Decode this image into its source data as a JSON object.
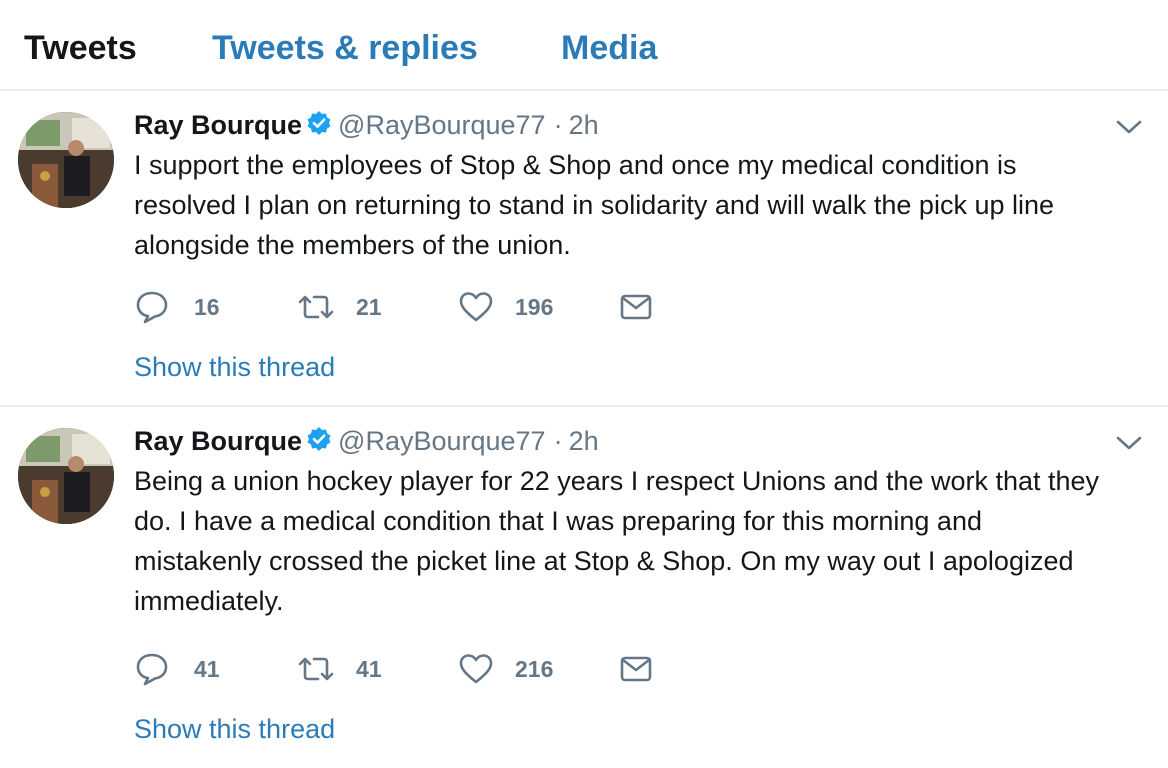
{
  "tabs": [
    {
      "label": "Tweets",
      "active": true
    },
    {
      "label": "Tweets & replies",
      "active": false
    },
    {
      "label": "Media",
      "active": false
    }
  ],
  "colors": {
    "accent": "#2b7bb9",
    "verified": "#1da1f2",
    "muted": "#657786",
    "divider": "#e6ecf0"
  },
  "tweets": [
    {
      "name": "Ray Bourque",
      "verified": true,
      "handle": "@RayBourque77",
      "separator": "·",
      "time": "2h",
      "text": "I support the employees of Stop & Shop and once my medical condition is\nresolved I plan on returning to stand in solidarity and will walk the pick up line\nalongside the members of the union.",
      "replies": "16",
      "retweets": "21",
      "likes": "196",
      "thread_link": "Show this thread"
    },
    {
      "name": "Ray Bourque",
      "verified": true,
      "handle": "@RayBourque77",
      "separator": "·",
      "time": "2h",
      "text": "Being a union hockey player for 22 years I respect Unions and the work that they\ndo. I have a medical condition that I was preparing for this morning and\nmistakenly crossed the picket line at Stop & Shop. On my way out I apologized\nimmediately.",
      "replies": "41",
      "retweets": "41",
      "likes": "216",
      "thread_link": "Show this thread"
    }
  ],
  "icons": [
    "verified-badge-icon",
    "chevron-down-icon",
    "reply-icon",
    "retweet-icon",
    "like-icon",
    "direct-message-icon"
  ]
}
